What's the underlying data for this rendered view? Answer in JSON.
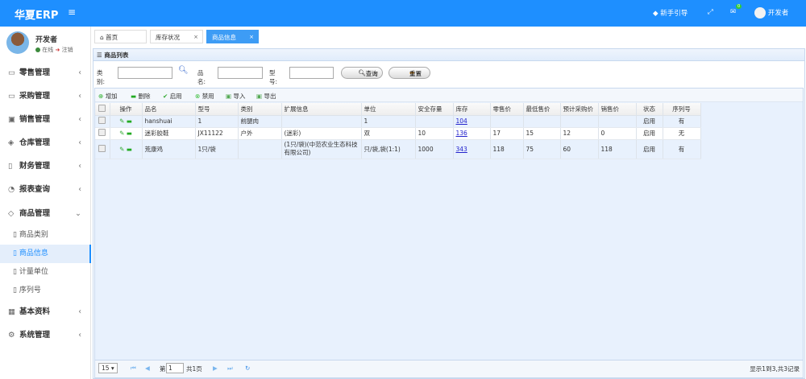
{
  "header": {
    "logo": "华夏ERP",
    "menu_icon": "≡",
    "guide": "新手引导",
    "mail_badge": "0",
    "user": "开发者"
  },
  "user": {
    "name": "开发者",
    "online": "在线",
    "logout": "注销"
  },
  "sidebar": {
    "menus": [
      {
        "label": "零售管理",
        "icon": "gift-icon"
      },
      {
        "label": "采购管理",
        "icon": "monitor-icon"
      },
      {
        "label": "销售管理",
        "icon": "briefcase-icon"
      },
      {
        "label": "仓库管理",
        "icon": "layers-icon"
      },
      {
        "label": "财务管理",
        "icon": "book-icon"
      },
      {
        "label": "报表查询",
        "icon": "chart-icon"
      },
      {
        "label": "商品管理",
        "icon": "cube-icon"
      }
    ],
    "submenus": [
      "商品类别",
      "商品信息",
      "计量单位",
      "序列号"
    ],
    "menus2": [
      {
        "label": "基本资料",
        "icon": "grid-icon"
      },
      {
        "label": "系统管理",
        "icon": "gear-icon"
      }
    ]
  },
  "tabs": [
    "首页",
    "库存状况",
    "商品信息"
  ],
  "panel": {
    "title": "商品列表"
  },
  "search": {
    "category_label": "类别:",
    "name_label": "品名:",
    "model_label": "型号:",
    "query": "查询",
    "reset": "重置"
  },
  "toolbar": {
    "add": "增加",
    "delete": "删除",
    "enable": "启用",
    "disable": "禁用",
    "import": "导入",
    "export": "导出"
  },
  "table": {
    "headers": [
      "操作",
      "品名",
      "型号",
      "类别",
      "扩展信息",
      "单位",
      "安全存量",
      "库存",
      "零售价",
      "最低售价",
      "预计采购价",
      "销售价",
      "状态",
      "序列号"
    ],
    "rows": [
      [
        "hanshuai",
        "1",
        "前腿肉",
        "",
        "1",
        "",
        "104",
        "",
        "",
        "",
        "",
        "启用",
        "有"
      ],
      [
        "迷彩胶鞋",
        "JX11122",
        "户外",
        "(迷彩)",
        "双",
        "10",
        "136",
        "17",
        "15",
        "12",
        "0",
        "启用",
        "无"
      ],
      [
        "荒康鸡",
        "1只/袋",
        "",
        "(1只/袋)(中范农业生态科技有限公司)",
        "只/袋,袋(1:1)",
        "1000",
        "343",
        "118",
        "75",
        "60",
        "118",
        "启用",
        "有"
      ]
    ]
  },
  "pager": {
    "page_size": "15",
    "page_label": "第",
    "page": "1",
    "total_pages": "共1页",
    "summary": "显示1到3,共3记录"
  }
}
